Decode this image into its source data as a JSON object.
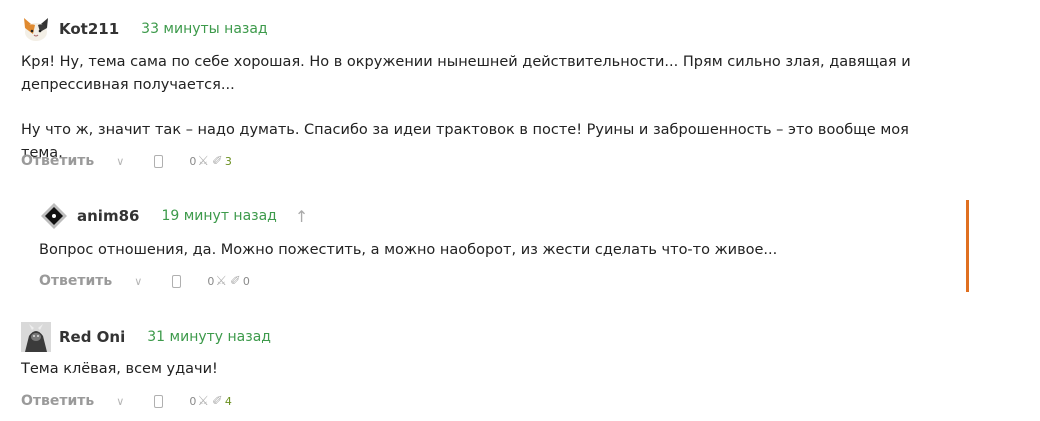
{
  "comments": [
    {
      "author": "Kot211",
      "time": "33 минуты назад",
      "body": [
        "Кря! Ну, тема сама по себе хорошая. Но в окружении нынешней действительности... Прям сильно злая, давящая и депрессивная получается...",
        "Ну что ж, значит так – надо думать. Спасибо за идеи трактовок в посте! Руины и заброшенность – это вообще моя тема."
      ],
      "reply_label": "Ответить",
      "count_a": "0",
      "count_b": "3",
      "icons": [
        "chevron-down-icon",
        "phone-icon",
        "sword-icon",
        "wand-icon"
      ]
    },
    {
      "author": "anim86",
      "time": "19 минут назад",
      "up_arrow": "↑",
      "body": [
        "Вопрос отношения, да. Можно пожестить, а можно наоборот, из жести сделать что-то живое..."
      ],
      "reply_label": "Ответить",
      "count_a": "0",
      "count_b": "0",
      "branch_color": "#e07020"
    },
    {
      "author": "Red Oni",
      "time": "31 минуту назад",
      "body": [
        "Тема клёвая, всем удачи!"
      ],
      "reply_label": "Ответить",
      "count_a": "0",
      "count_b": "4"
    }
  ],
  "colors": {
    "time": "#3d9a4b",
    "count_positive": "#6a8f1f",
    "branch": "#e07020"
  }
}
